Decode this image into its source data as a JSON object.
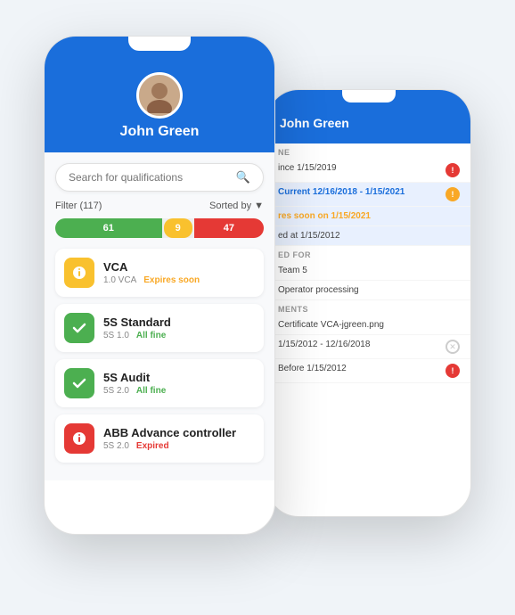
{
  "scene": {
    "background": "#f0f4f8"
  },
  "phone_back": {
    "header": {
      "name": "John Green"
    },
    "rows": [
      {
        "label": "NE",
        "type": "section"
      },
      {
        "label": "ince 1/15/2019",
        "status": "warning-red"
      },
      {
        "label": "Current 12/16/2018 - 1/15/2021",
        "status": "warning-yellow",
        "highlighted": true
      },
      {
        "label": "res soon on 1/15/2021",
        "status": "info-yellow",
        "highlighted": true
      },
      {
        "label": "ed at 1/15/2012",
        "status": "",
        "highlighted": true
      },
      {
        "label": "ed for",
        "type": "section"
      },
      {
        "label": "Team 5",
        "status": ""
      },
      {
        "label": "Operator processing",
        "status": ""
      },
      {
        "label": "ments",
        "type": "section"
      },
      {
        "label": "Certificate VCA-jgreen.png",
        "status": ""
      },
      {
        "label": "1/15/2012 - 12/16/2018",
        "status": "ok"
      },
      {
        "label": "Before 1/15/2012",
        "status": "warning-red"
      }
    ]
  },
  "phone_front": {
    "header": {
      "name": "John Green",
      "avatar_alt": "John Green avatar"
    },
    "search": {
      "placeholder": "Search for qualifications"
    },
    "filter": {
      "label": "Filter (117)",
      "sorted_by": "Sorted by"
    },
    "progress": {
      "green": 61,
      "yellow": 9,
      "red": 47
    },
    "qualifications": [
      {
        "name": "VCA",
        "meta": "1.0 VCA",
        "status": "Expires soon",
        "status_class": "status-expires-soon",
        "icon_type": "yellow",
        "icon": "bell"
      },
      {
        "name": "5S Standard",
        "meta": "5S 1.0",
        "status": "All fine",
        "status_class": "status-all-fine",
        "icon_type": "green",
        "icon": "check"
      },
      {
        "name": "5S Audit",
        "meta": "5S 2.0",
        "status": "All fine",
        "status_class": "status-all-fine",
        "icon_type": "green",
        "icon": "check"
      },
      {
        "name": "ABB Advance controller",
        "meta": "5S 2.0",
        "status": "Expired",
        "status_class": "status-expired",
        "icon_type": "red",
        "icon": "bell"
      }
    ]
  }
}
